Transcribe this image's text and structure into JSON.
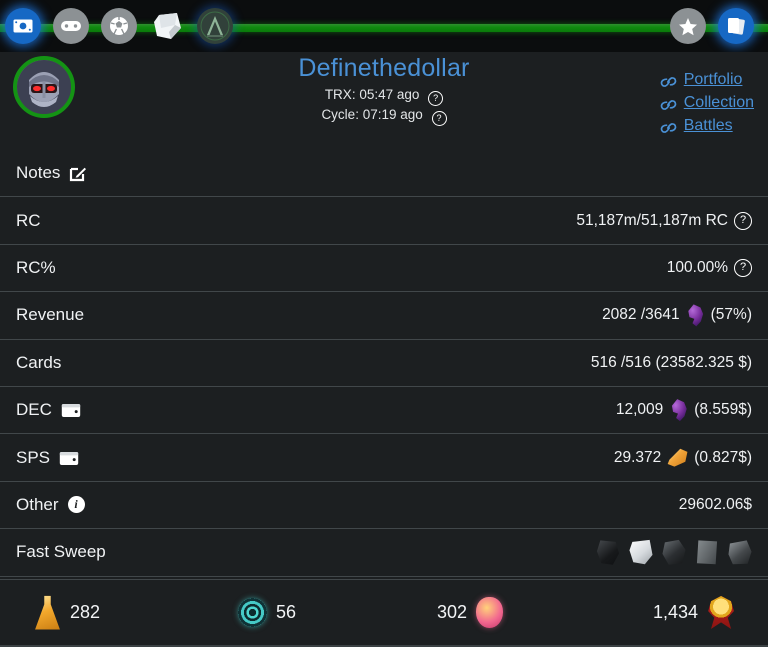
{
  "topnav": {
    "items": [
      {
        "name": "money-icon",
        "state": "active"
      },
      {
        "name": "gamepad-icon",
        "state": "default"
      },
      {
        "name": "soccer-ball-icon",
        "state": "default"
      },
      {
        "name": "card-pack-icon",
        "state": "default"
      },
      {
        "name": "emblem-a-icon",
        "state": "dim"
      }
    ],
    "right_items": [
      {
        "name": "star-icon",
        "state": "default"
      },
      {
        "name": "cards-icon",
        "state": "active"
      }
    ]
  },
  "header": {
    "avatar_name": "player-avatar",
    "title": "Definethedollar",
    "trx_label": "TRX:",
    "trx_value": "05:47 ago",
    "cycle_label": "Cycle:",
    "cycle_value": "07:19 ago",
    "help_glyph": "?",
    "links": [
      {
        "label": "Portfolio"
      },
      {
        "label": "Collection"
      },
      {
        "label": "Battles"
      }
    ]
  },
  "rows": [
    {
      "key": "notes",
      "label": "Notes",
      "value": ""
    },
    {
      "key": "rc",
      "label": "RC",
      "value": "51,187m/51,187m RC"
    },
    {
      "key": "rcpct",
      "label": "RC%",
      "value": "100.00%"
    },
    {
      "key": "revenue",
      "label": "Revenue",
      "value": "2082 /3641",
      "value2": "(57%)"
    },
    {
      "key": "cards",
      "label": "Cards",
      "value": "516 /516 (23582.325 $)"
    },
    {
      "key": "dec",
      "label": "DEC",
      "value": "12,009",
      "value2": "(8.559$)"
    },
    {
      "key": "sps",
      "label": "SPS",
      "value": "29.372",
      "value2": "(0.827$)"
    },
    {
      "key": "other",
      "label": "Other",
      "value": "29602.06$"
    },
    {
      "key": "fastsweep",
      "label": "Fast Sweep",
      "value": ""
    }
  ],
  "status_bar": [
    {
      "name": "gold-potion-icon",
      "value": "282",
      "order": "icon-first"
    },
    {
      "name": "spiral-icon",
      "value": "56",
      "order": "icon-first"
    },
    {
      "name": "pink-potion-icon",
      "value": "302",
      "order": "value-first"
    },
    {
      "name": "medal-icon",
      "value": "1,434",
      "order": "value-first"
    }
  ],
  "colors": {
    "accent_blue": "#4a91d6",
    "progress_green": "#0f8a0f",
    "background": "#1c1f21",
    "topbar": "#0b0d0e",
    "divider": "#41474a"
  }
}
